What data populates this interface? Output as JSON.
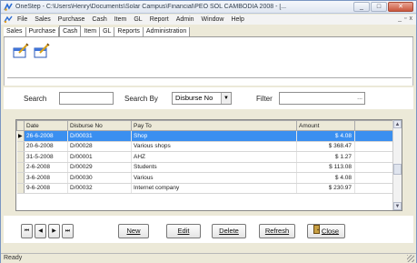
{
  "window": {
    "title": "OneStep - C:\\Users\\Henry\\Documents\\Solar Campus\\Financial\\PEO SOL CAMBODIA 2008 - [..."
  },
  "window_buttons": {
    "minimize": "_",
    "maximize": "□",
    "close": "✕"
  },
  "menu": {
    "items": [
      "File",
      "Sales",
      "Purchase",
      "Cash",
      "Item",
      "GL",
      "Report",
      "Admin",
      "Window",
      "Help"
    ],
    "mdi": [
      "_",
      "▫",
      "x"
    ]
  },
  "tabs": [
    {
      "label": "Sales"
    },
    {
      "label": "Purchase"
    },
    {
      "label": "Cash",
      "active": true
    },
    {
      "label": "Item"
    },
    {
      "label": "GL"
    },
    {
      "label": "Reports"
    },
    {
      "label": "Administration"
    }
  ],
  "search": {
    "search_label": "Search",
    "search_value": "",
    "search_by_label": "Search By",
    "search_by_value": "Disburse No",
    "filter_label": "Filter",
    "filter_value": "",
    "filter_button": "..."
  },
  "grid": {
    "columns": [
      "Date",
      "Disburse No",
      "Pay To",
      "Amount"
    ],
    "rows": [
      {
        "date": "26-6-2008",
        "no": "D/00031",
        "pay_to": "Shop",
        "amount": "$ 4.08",
        "selected": true,
        "indicator": "▶"
      },
      {
        "date": "20-6-2008",
        "no": "D/00028",
        "pay_to": "Various shops",
        "amount": "$ 368.47",
        "selected": false,
        "indicator": ""
      },
      {
        "date": "31-5-2008",
        "no": "D/00001",
        "pay_to": "AHZ",
        "amount": "$ 1.27",
        "selected": false,
        "indicator": ""
      },
      {
        "date": "2-6-2008",
        "no": "D/00029",
        "pay_to": "Students",
        "amount": "$ 113.08",
        "selected": false,
        "indicator": ""
      },
      {
        "date": "3-6-2008",
        "no": "D/00030",
        "pay_to": "Various",
        "amount": "$ 4.08",
        "selected": false,
        "indicator": ""
      },
      {
        "date": "9-6-2008",
        "no": "D/00032",
        "pay_to": "Internet company",
        "amount": "$ 230.97",
        "selected": false,
        "indicator": ""
      }
    ]
  },
  "buttons": {
    "first": "⏮",
    "prev": "◀",
    "next": "▶",
    "last": "⏭",
    "new": "New",
    "edit": "Edit",
    "delete": "Delete",
    "refresh": "Refresh",
    "close": "Close"
  },
  "status": {
    "text": "Ready"
  }
}
